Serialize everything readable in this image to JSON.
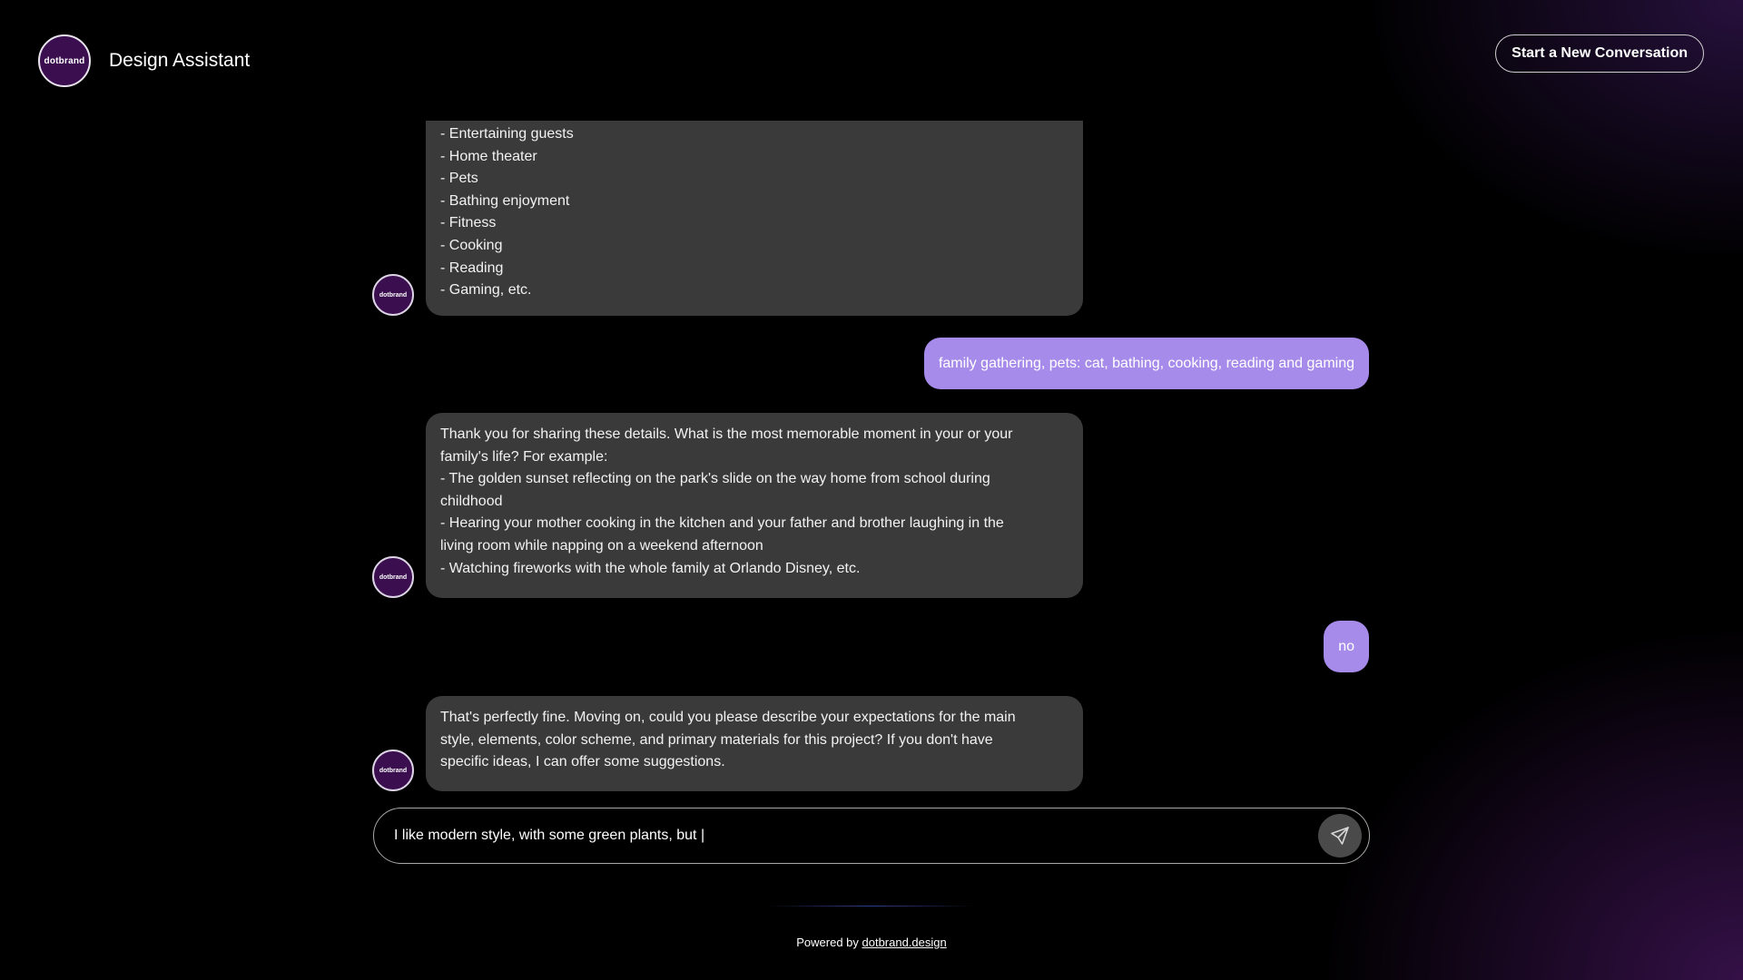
{
  "header": {
    "logo_text": "dotbrand",
    "title": "Design Assistant",
    "new_conversation_label": "Start a New Conversation"
  },
  "avatar_text": "dotbrand",
  "messages": {
    "bot1": {
      "lines": [
        "- Entertaining guests",
        "- Home theater",
        "- Pets",
        "- Bathing enjoyment",
        "- Fitness",
        "- Cooking",
        "- Reading",
        "- Gaming, etc."
      ]
    },
    "user1": {
      "text": "family gathering, pets: cat, bathing, cooking, reading and gaming"
    },
    "bot2": {
      "lines": [
        "Thank you for sharing these details. What is the most memorable moment in your or your",
        "family's life? For example:",
        "- The golden sunset reflecting on the park's slide on the way home from school during",
        "childhood",
        "- Hearing your mother cooking in the kitchen and your father and brother laughing in the",
        "living room while napping on a weekend afternoon",
        "- Watching fireworks with the whole family at Orlando Disney, etc."
      ]
    },
    "user2": {
      "text": "no"
    },
    "bot3": {
      "lines": [
        "That's perfectly fine. Moving on, could you please describe your expectations for the main",
        "style, elements, color scheme, and primary materials for this project? If you don't have",
        "specific ideas, I can offer some suggestions."
      ]
    }
  },
  "composer": {
    "value": "I like modern style, with some green plants, but |",
    "send_icon": "paper-plane-icon"
  },
  "footer": {
    "prefix": "Powered by ",
    "link_text": "dotbrand.design"
  },
  "colors": {
    "background": "#000000",
    "bot_bubble": "#3a3a3a",
    "user_bubble": "#a78bea",
    "brand_purple": "#3a0e4f"
  }
}
